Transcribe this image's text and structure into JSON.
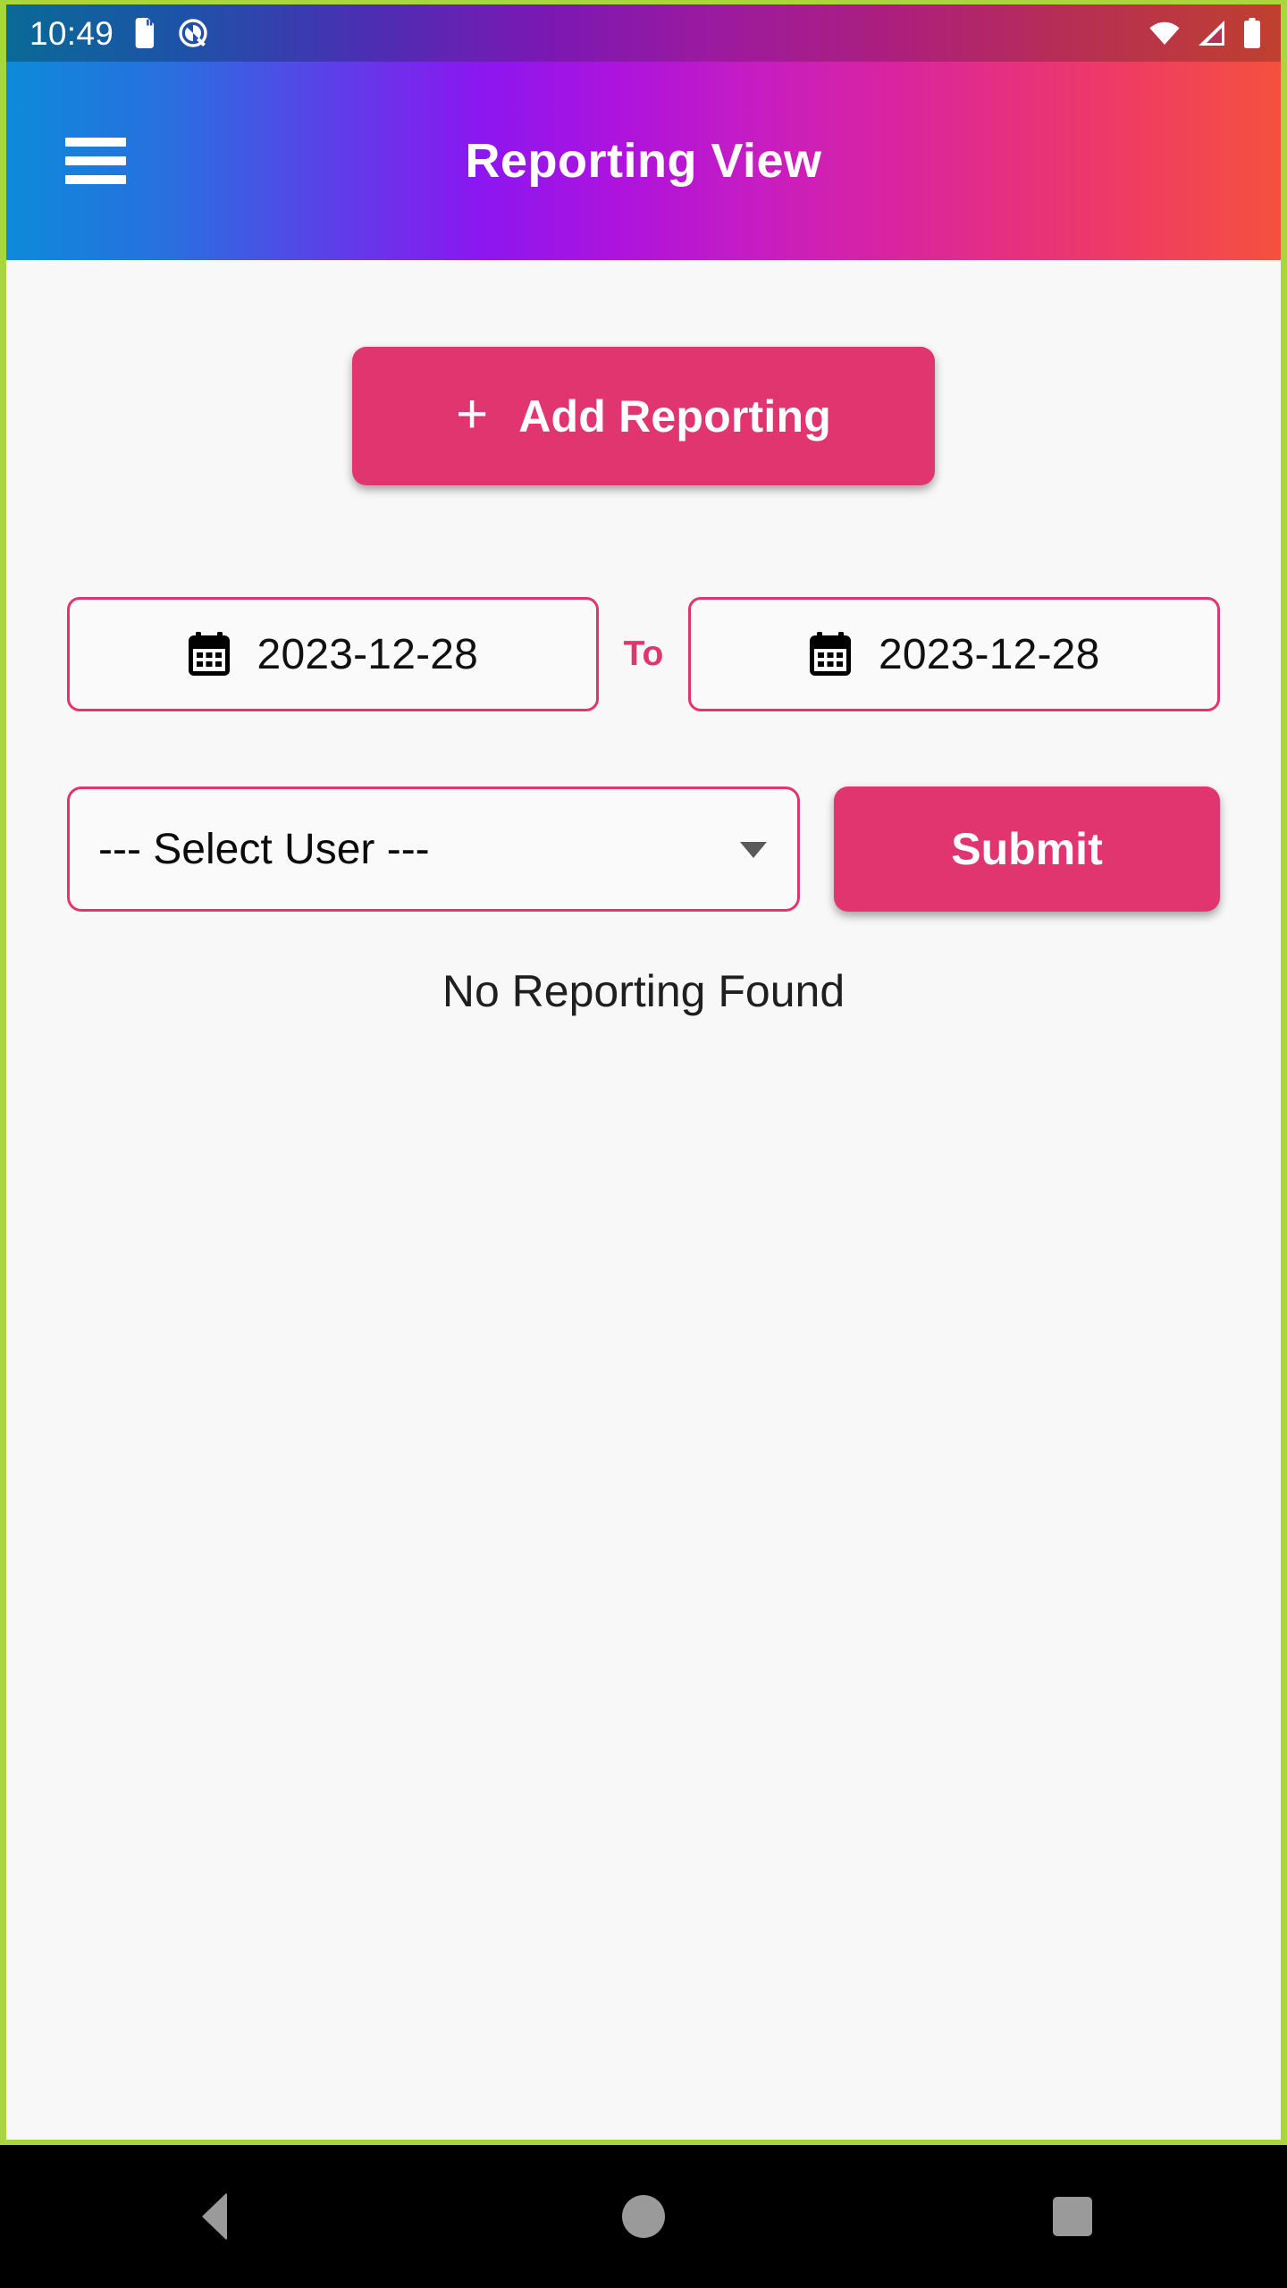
{
  "status_bar": {
    "time": "10:49",
    "icons_left": [
      "sd-card-icon",
      "data-saver-icon"
    ],
    "icons_right": [
      "wifi-icon",
      "cellular-signal-icon",
      "battery-icon"
    ]
  },
  "app_bar": {
    "menu_icon": "hamburger-menu-icon",
    "title": "Reporting View"
  },
  "main": {
    "add_button": {
      "icon": "plus-icon",
      "label": "Add Reporting"
    },
    "date_range": {
      "from": {
        "icon": "calendar-icon",
        "value": "2023-12-28"
      },
      "separator": "To",
      "to": {
        "icon": "calendar-icon",
        "value": "2023-12-28"
      }
    },
    "user_select": {
      "value": "--- Select User ---",
      "caret": "chevron-down-icon"
    },
    "submit_button": {
      "label": "Submit"
    },
    "empty_state": "No Reporting Found"
  },
  "nav_bar": {
    "back": "back-triangle-icon",
    "home": "home-circle-icon",
    "recents": "recents-square-icon"
  },
  "colors": {
    "accent": "#e0356f",
    "frame": "#a9d63c",
    "surface": "#f8f8f8",
    "nav_icon": "#9a9a9a"
  }
}
